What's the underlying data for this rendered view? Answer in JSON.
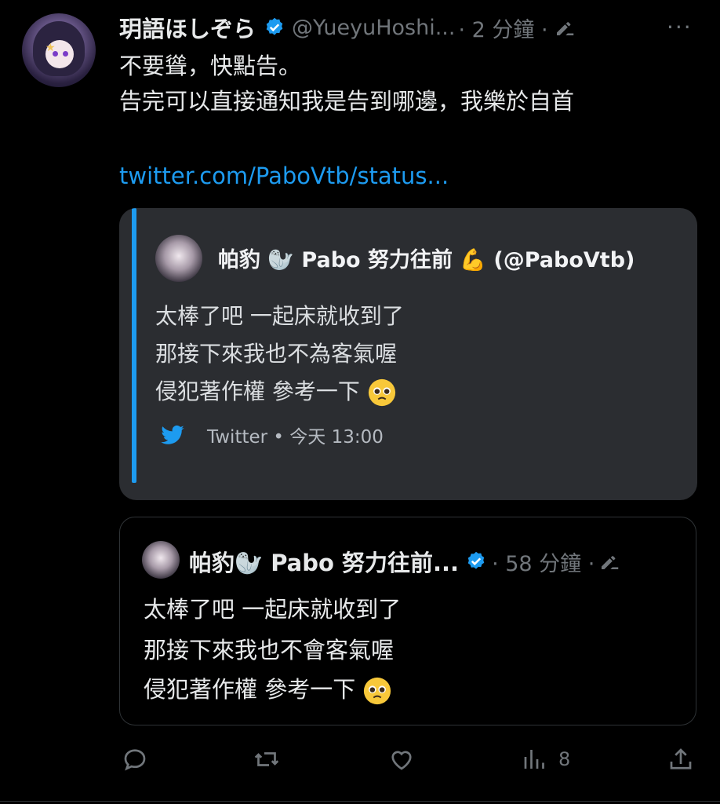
{
  "tweet": {
    "name": "玥語ほしぞら",
    "handle": "@YueyuHoshi...",
    "time_meta": "· 2 分鐘 ·",
    "more_label": "···",
    "text_lines": [
      "不要聳，快點告。",
      "告完可以直接通知我是告到哪邊，我樂於自首"
    ],
    "link": "twitter.com/PaboVtb/status..."
  },
  "embed": {
    "author": "帕豹 🦭 Pabo 努力往前 💪 (@PaboVtb)",
    "lines": [
      "太棒了吧 一起床就收到了",
      "那接下來我也不為客氣喔",
      "侵犯著作權 參考一下"
    ],
    "footer": "Twitter • 今天 13:00"
  },
  "quote": {
    "name": "帕豹🦭 Pabo 努力往前...",
    "time_meta": "· 58 分鐘 ·",
    "lines": [
      "太棒了吧 一起床就收到了",
      "那接下來我也不會客氣喔",
      "侵犯著作權 參考一下"
    ]
  },
  "actions": {
    "views_count": "8"
  },
  "colors": {
    "accent": "#1d9bf0",
    "muted": "#71767b",
    "embed_bg": "#2b2d31"
  },
  "icons": [
    "verified-icon",
    "edit-icon",
    "reply-icon",
    "retweet-icon",
    "like-icon",
    "views-icon",
    "share-icon",
    "twitter-bird-icon",
    "pleading-face-emoji"
  ]
}
